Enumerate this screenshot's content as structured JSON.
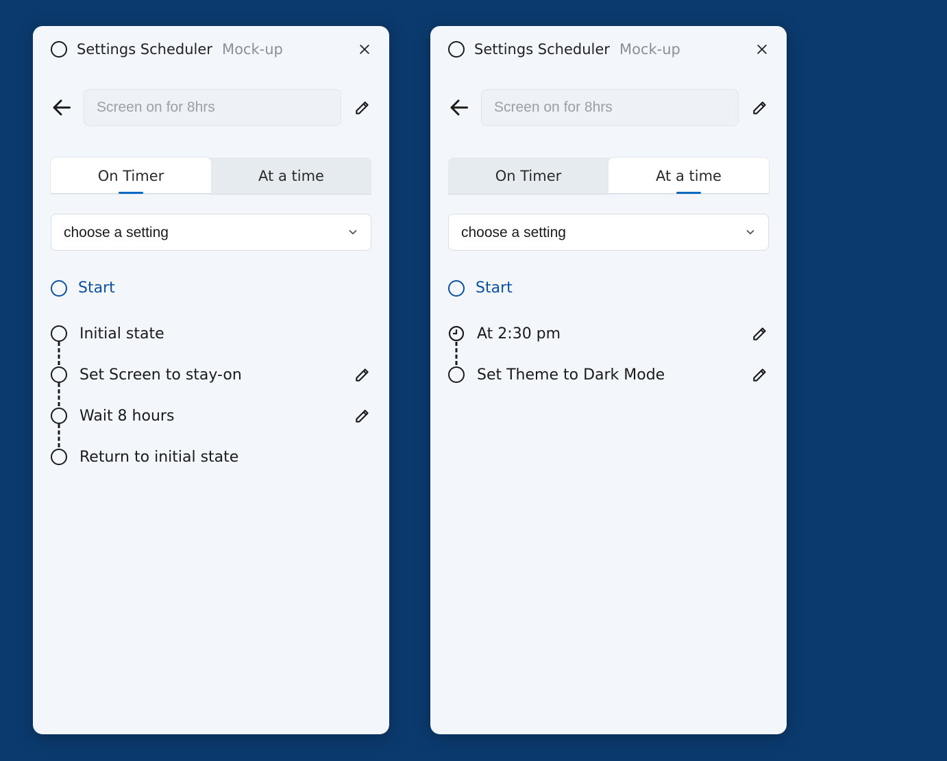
{
  "app_title": "Settings Scheduler",
  "app_subtitle": "Mock-up",
  "name_placeholder": "Screen on for 8hrs",
  "tabs": {
    "on_timer": "On Timer",
    "at_a_time": "At a time"
  },
  "setting_select_placeholder": "choose a setting",
  "start_label": "Start",
  "panel_a": {
    "active_tab": "on_timer",
    "steps": [
      {
        "label": "Initial state",
        "editable": false,
        "icon": "circle"
      },
      {
        "label": "Set Screen to stay-on",
        "editable": true,
        "icon": "circle"
      },
      {
        "label": "Wait 8 hours",
        "editable": true,
        "icon": "circle"
      },
      {
        "label": "Return to initial state",
        "editable": false,
        "icon": "circle"
      }
    ]
  },
  "panel_b": {
    "active_tab": "at_a_time",
    "steps": [
      {
        "label": "At 2:30 pm",
        "editable": true,
        "icon": "clock"
      },
      {
        "label": "Set Theme to Dark Mode",
        "editable": true,
        "icon": "circle"
      }
    ]
  }
}
